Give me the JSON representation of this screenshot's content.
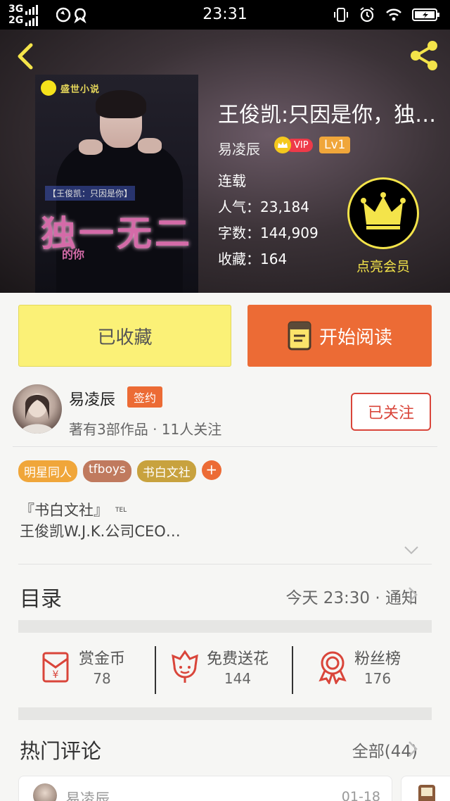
{
  "status_bar": {
    "network_1": "3G",
    "network_2": "2G",
    "time": "23:31"
  },
  "book": {
    "title": "王俊凯:只因是你，独…",
    "author": "易凌辰",
    "vip_label": "VIP",
    "level": "Lv1",
    "status": "连载",
    "popularity": "人气：23,184",
    "word_count": "字数：144,909",
    "favorites": "收藏：164",
    "member_label": "点亮会员"
  },
  "cover": {
    "brand": "盛世小说",
    "small_title": "【王俊凯：只因是你】",
    "big_title": "独一无二",
    "sub": "的你"
  },
  "actions": {
    "collected": "已收藏",
    "start_reading": "开始阅读"
  },
  "author": {
    "name": "易凌辰",
    "badge": "签约",
    "meta": "著有3部作品 · 11人关注",
    "follow": "已关注"
  },
  "tags": [
    {
      "label": "明星同人",
      "color": "#f0a63a"
    },
    {
      "label": "tfboys",
      "color": "#c07a5e"
    },
    {
      "label": "书白文社",
      "color": "#c8a23e"
    }
  ],
  "intro": {
    "line1": "『书白文社』",
    "tel": "TEL",
    "line2": "王俊凯W.J.K.公司CEO…"
  },
  "catalog": {
    "title": "目录",
    "update": "今天 23:30 · 通知"
  },
  "rewards": [
    {
      "label": "赏金币",
      "value": "78",
      "icon": "red-envelope-icon"
    },
    {
      "label": "免费送花",
      "value": "144",
      "icon": "flower-icon"
    },
    {
      "label": "粉丝榜",
      "value": "176",
      "icon": "medal-icon"
    }
  ],
  "comments": {
    "title": "热门评论",
    "all": "全部(44)",
    "first_user": "易凌辰",
    "first_date": "01-18"
  },
  "colors": {
    "accent": "#ec6b35",
    "collected_bg": "#fbf177",
    "member_gold": "#f4e44a",
    "follow_red": "#d9453a"
  }
}
